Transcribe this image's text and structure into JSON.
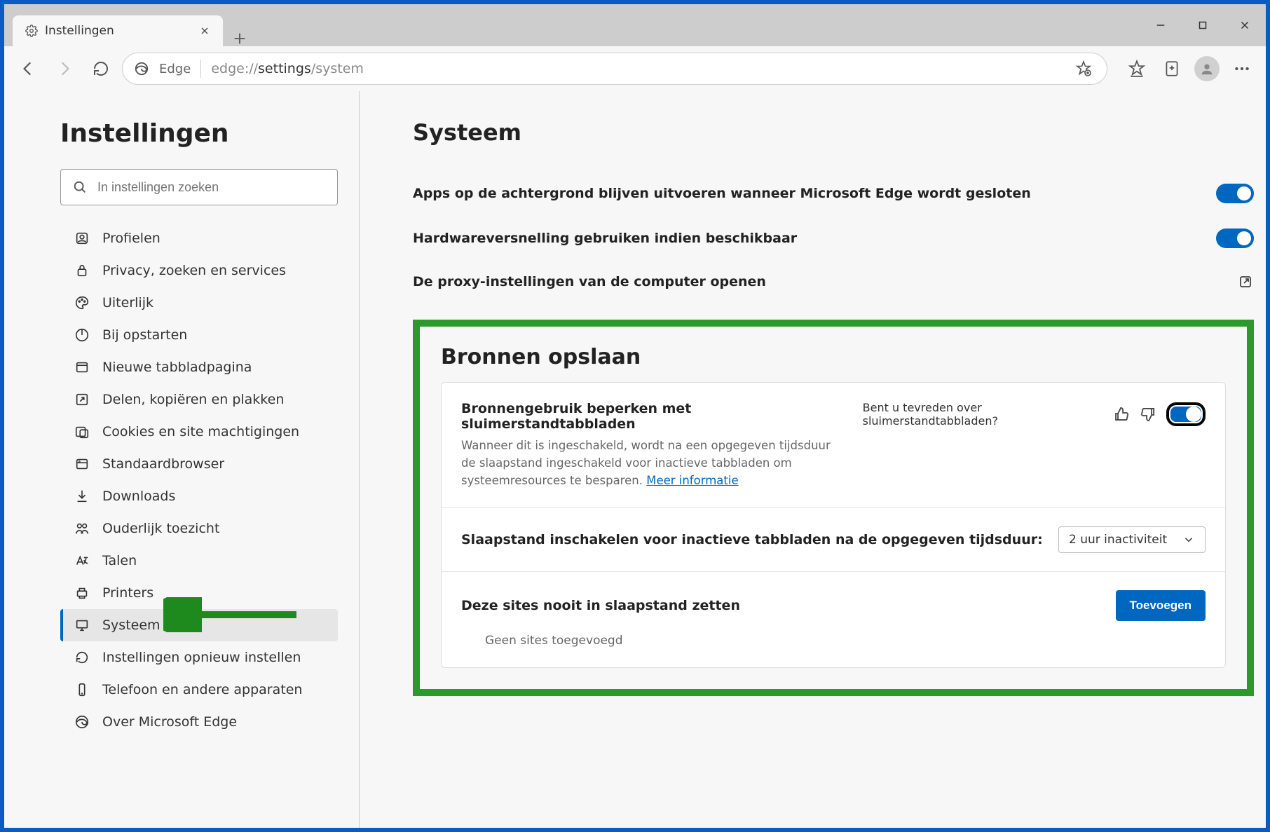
{
  "tab": {
    "title": "Instellingen"
  },
  "toolbar": {
    "edge_label": "Edge",
    "url_prefix": "edge://",
    "url_segment": "settings",
    "url_suffix": "/system"
  },
  "sidebar": {
    "title": "Instellingen",
    "search_placeholder": "In instellingen zoeken",
    "items": [
      {
        "label": "Profielen"
      },
      {
        "label": "Privacy, zoeken en services"
      },
      {
        "label": "Uiterlijk"
      },
      {
        "label": "Bij opstarten"
      },
      {
        "label": "Nieuwe tabbladpagina"
      },
      {
        "label": "Delen, kopiëren en plakken"
      },
      {
        "label": "Cookies en site machtigingen"
      },
      {
        "label": "Standaardbrowser"
      },
      {
        "label": "Downloads"
      },
      {
        "label": "Ouderlijk toezicht"
      },
      {
        "label": "Talen"
      },
      {
        "label": "Printers"
      },
      {
        "label": "Systeem"
      },
      {
        "label": "Instellingen opnieuw instellen"
      },
      {
        "label": "Telefoon en andere apparaten"
      },
      {
        "label": "Over Microsoft Edge"
      }
    ]
  },
  "main": {
    "title": "Systeem",
    "rows": {
      "background_apps": "Apps op de achtergrond blijven uitvoeren wanneer Microsoft Edge wordt gesloten",
      "hw_accel": "Hardwareversnelling gebruiken indien beschikbaar",
      "proxy": "De proxy-instellingen van de computer openen"
    },
    "resources": {
      "title": "Bronnen opslaan",
      "limit_label": "Bronnengebruik beperken met sluimerstandtabbladen",
      "limit_desc": "Wanneer dit is ingeschakeld, wordt na een opgegeven tijdsduur de slaapstand ingeschakeld voor inactieve tabbladen om systeemresources te besparen. ",
      "learn_more": "Meer informatie",
      "feedback_q": "Bent u tevreden over sluimerstandtabbladen?",
      "sleep_after_label": "Slaapstand inschakelen voor inactieve tabbladen na de opgegeven tijdsduur:",
      "sleep_select_value": "2 uur inactiviteit",
      "never_sleep_label": "Deze sites nooit in slaapstand zetten",
      "add_button": "Toevoegen",
      "no_sites": "Geen sites toegevoegd"
    }
  }
}
